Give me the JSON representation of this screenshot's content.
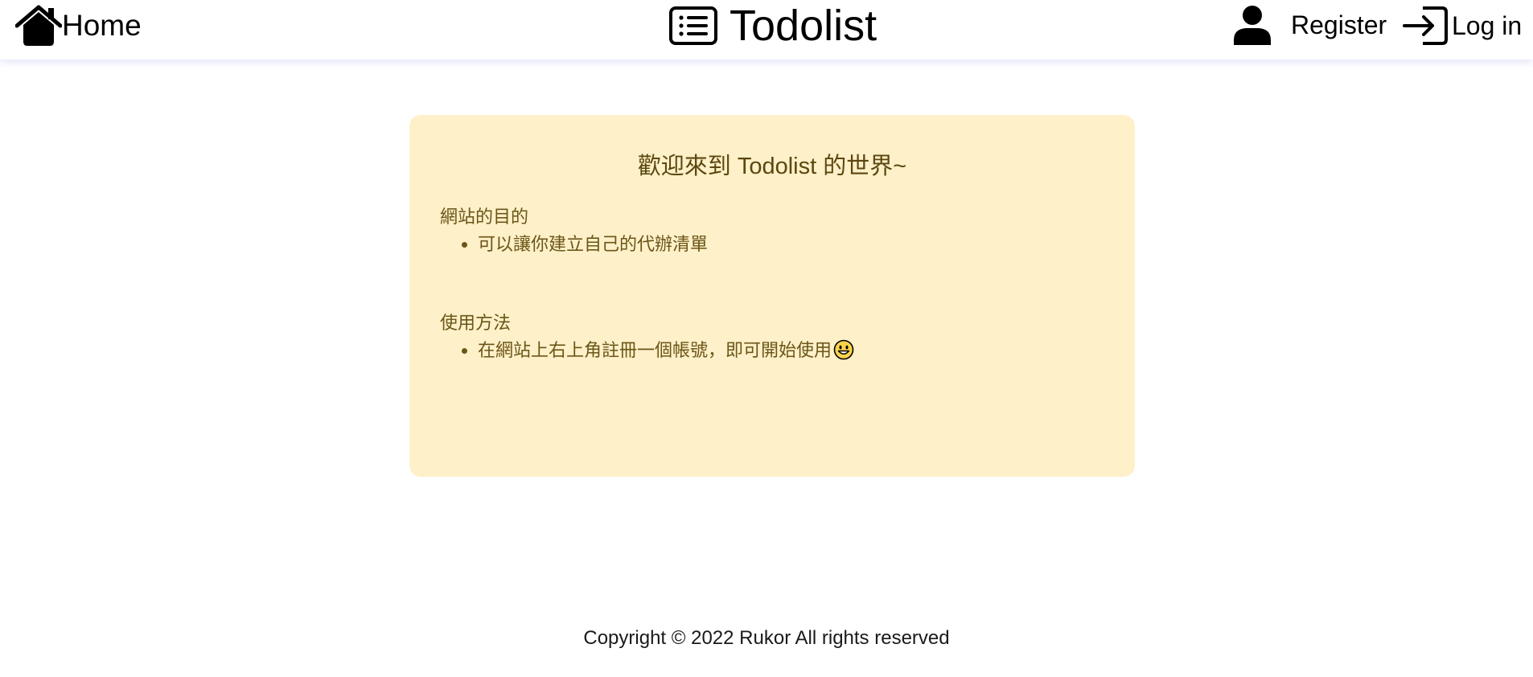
{
  "nav": {
    "home_label": "Home",
    "brand_title": "Todolist",
    "register_label": "Register",
    "login_label": "Log in"
  },
  "card": {
    "title": "歡迎來到 Todolist 的世界~",
    "sections": [
      {
        "heading": "網站的目的",
        "items": [
          "可以讓你建立自己的代辦清單"
        ]
      },
      {
        "heading": "使用方法",
        "items": [
          "在網站上右上角註冊一個帳號，即可開始使用"
        ]
      }
    ]
  },
  "footer": {
    "text": "Copyright © 2022 Rukor All rights reserved"
  },
  "icons": {
    "home": "house-icon",
    "brand": "list-icon",
    "register": "person-icon",
    "login": "login-arrow-icon",
    "emoji": "smiley-face-icon"
  },
  "colors": {
    "card_background": "#fef0c8",
    "card_text": "#6b5518",
    "navbar_shadow": "#7882dc"
  }
}
